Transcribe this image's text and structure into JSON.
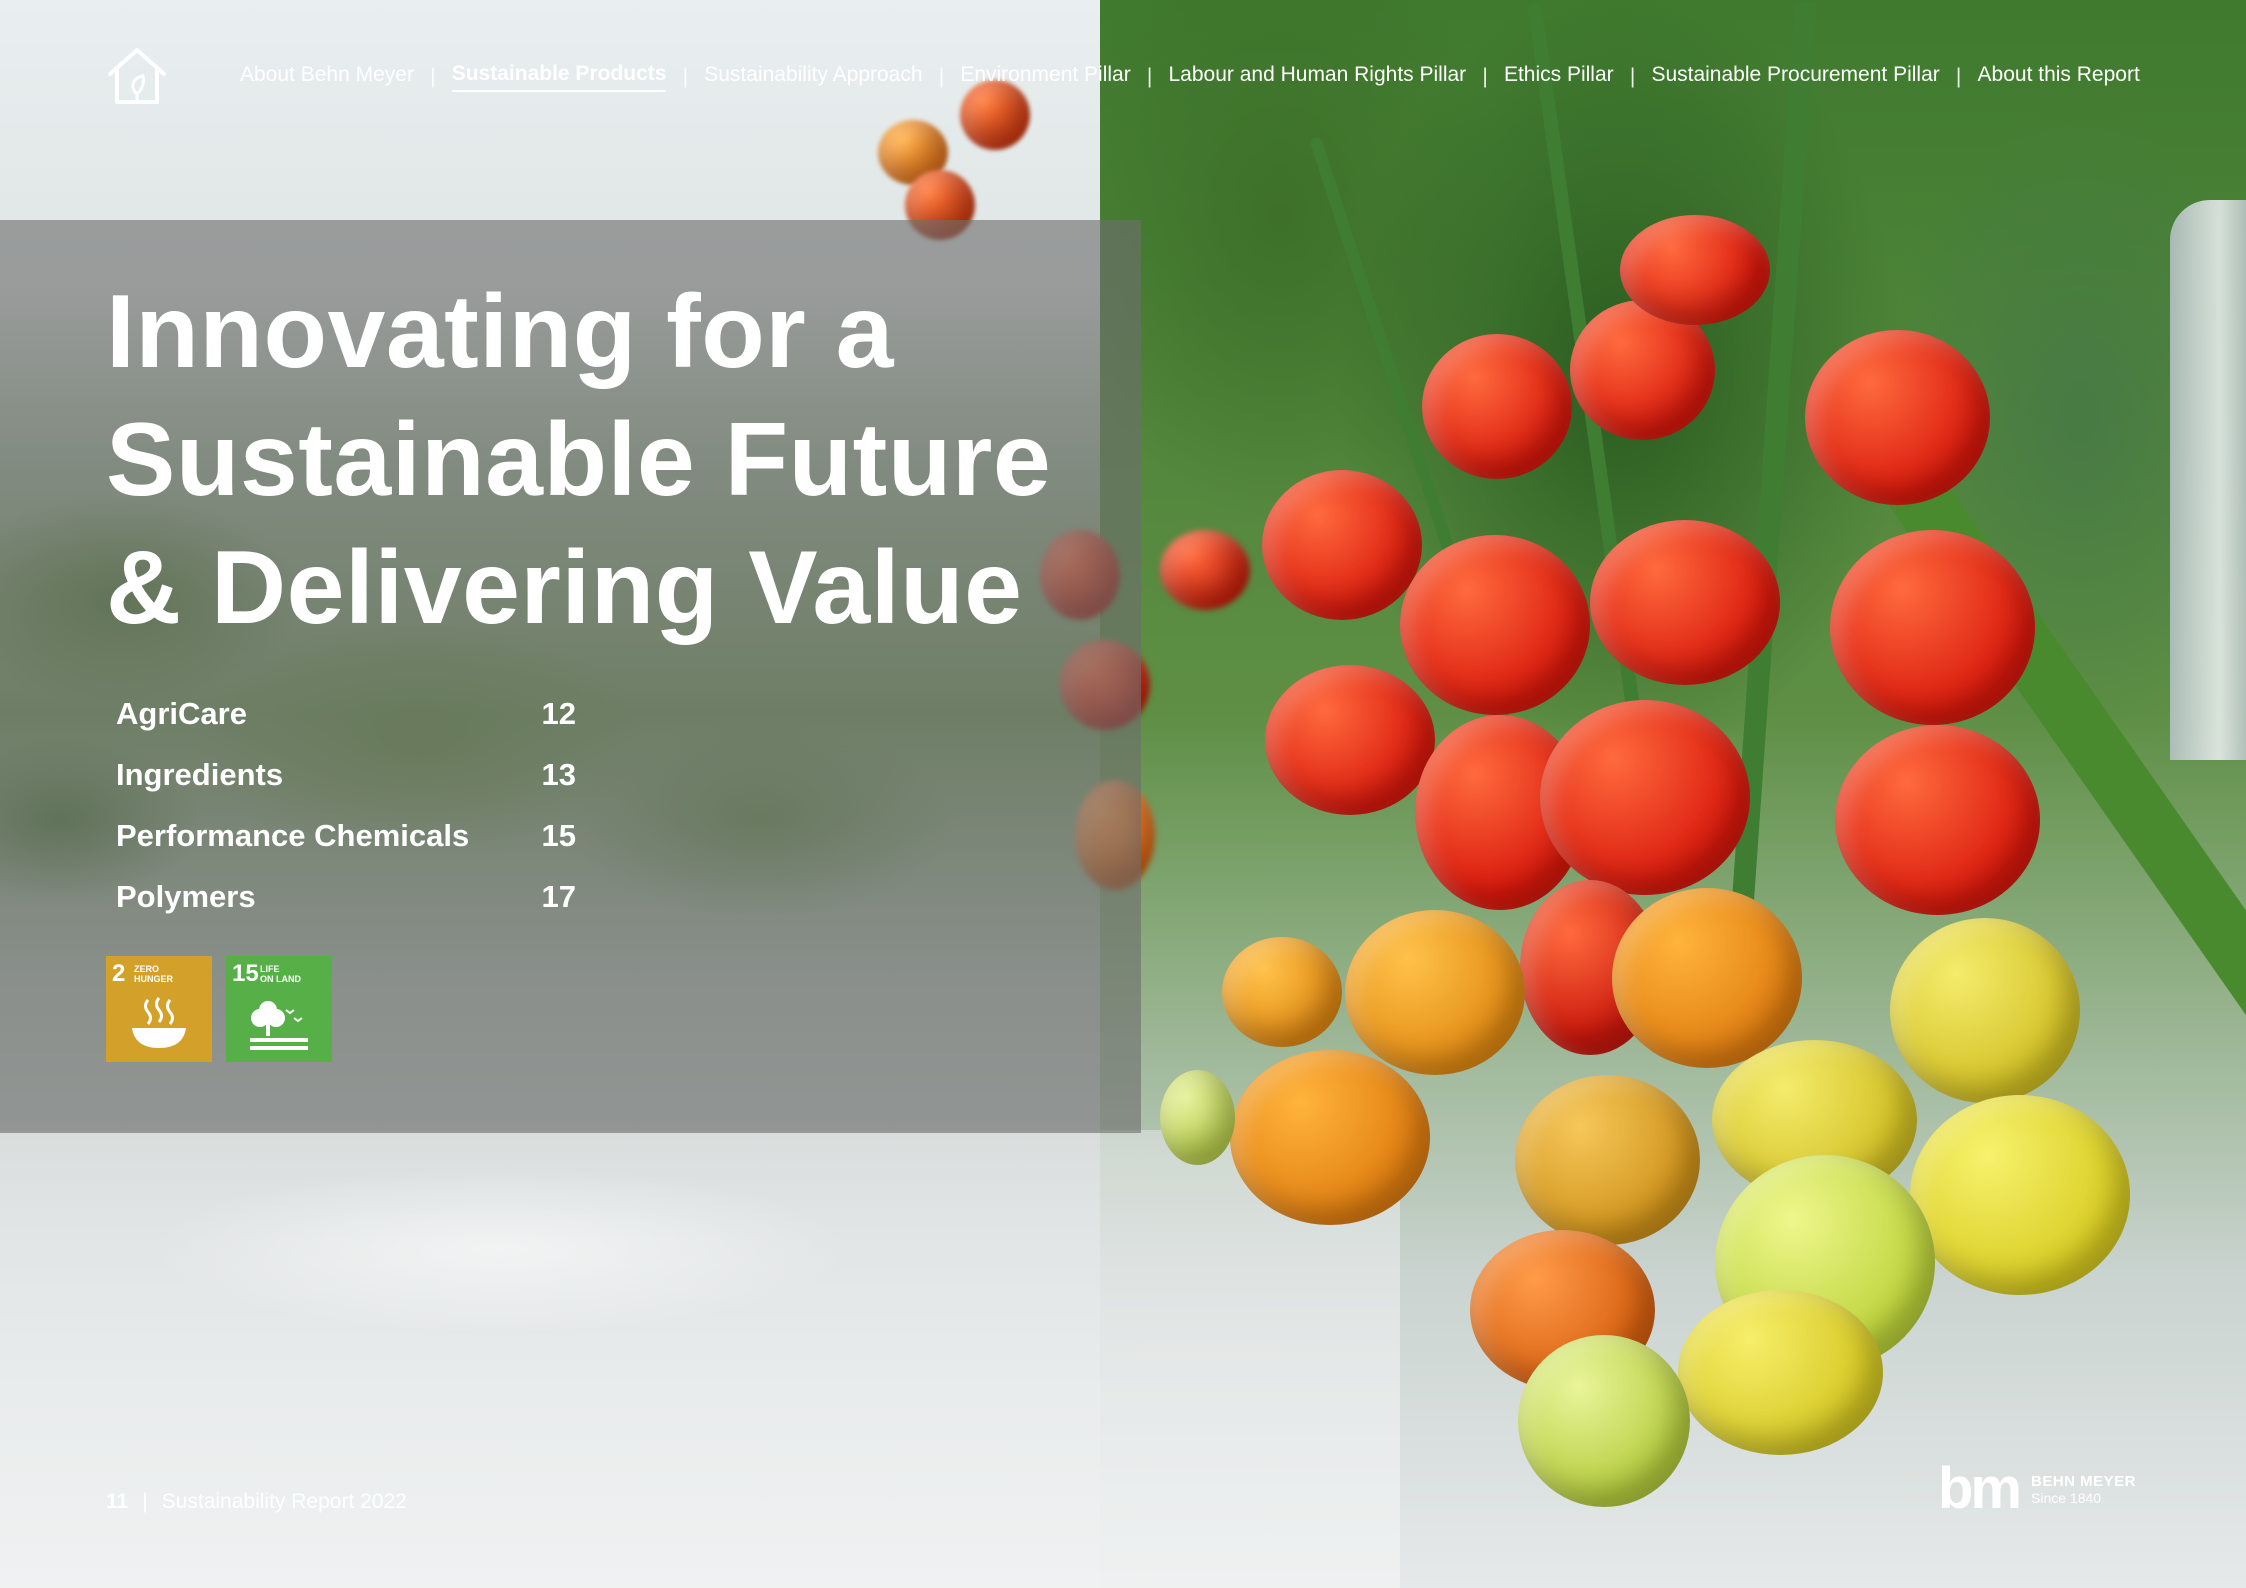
{
  "nav": {
    "items": [
      {
        "label": "About Behn Meyer"
      },
      {
        "label": "Sustainable Products"
      },
      {
        "label": "Sustainability Approach"
      },
      {
        "label": "Environment Pillar"
      },
      {
        "label": "Labour and Human Rights Pillar"
      },
      {
        "label": "Ethics Pillar"
      },
      {
        "label": "Sustainable Procurement Pillar"
      },
      {
        "label": "About this Report"
      }
    ],
    "active_index": 1
  },
  "hero": {
    "title_lines": [
      "Innovating for a",
      "Sustainable Future",
      "& Delivering Value"
    ]
  },
  "toc": [
    {
      "label": "AgriCare",
      "page": "12"
    },
    {
      "label": "Ingredients",
      "page": "13"
    },
    {
      "label": "Performance Chemicals",
      "page": "15"
    },
    {
      "label": "Polymers",
      "page": "17"
    }
  ],
  "sdg": [
    {
      "number": "2",
      "line1": "ZERO",
      "line2": "HUNGER",
      "color": "#d3a029",
      "icon": "bowl-icon"
    },
    {
      "number": "15",
      "line1": "LIFE",
      "line2": "ON LAND",
      "color": "#56b047",
      "icon": "tree-icon"
    }
  ],
  "footer": {
    "page_number": "11",
    "report_title": "Sustainability Report 2022"
  },
  "logo": {
    "mark": "bm",
    "name": "BEHN MEYER",
    "tagline": "Since 1840"
  }
}
